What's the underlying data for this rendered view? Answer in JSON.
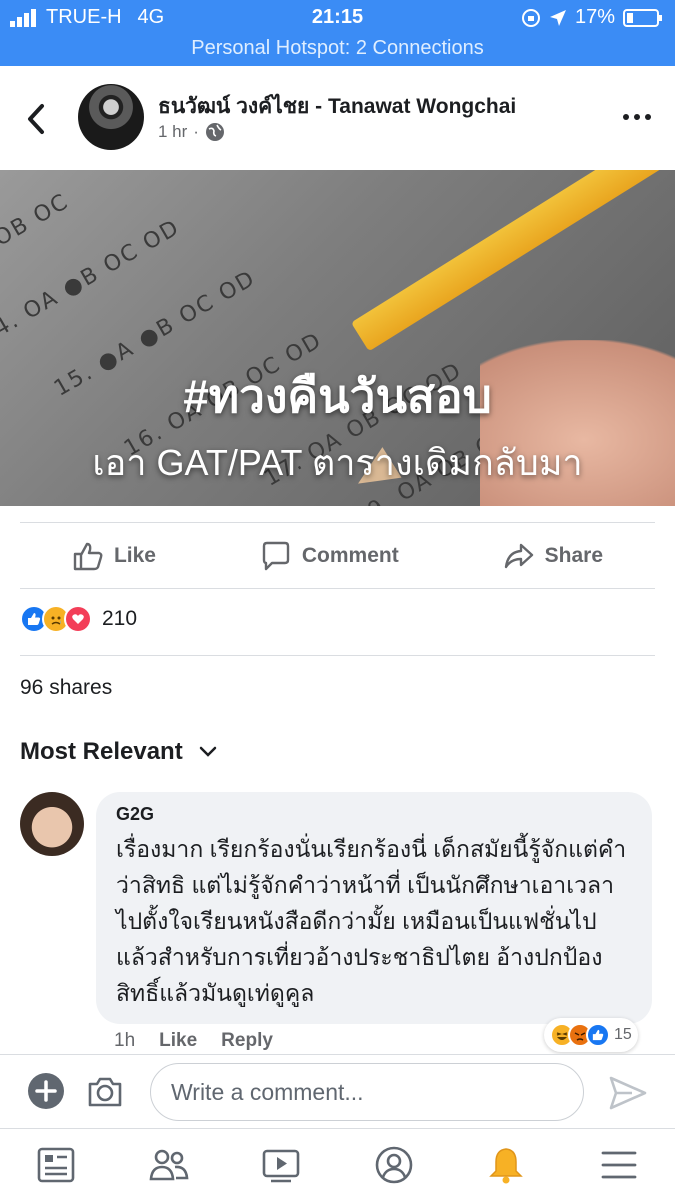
{
  "status_bar": {
    "carrier": "TRUE-H",
    "network": "4G",
    "time": "21:15",
    "battery": "17%"
  },
  "hotspot_banner": "Personal Hotspot: 2 Connections",
  "post": {
    "author": "ธนวัฒน์ วงค์ไชย - Tanawat Wongchai",
    "time_ago": "1 hr",
    "privacy_icon": "globe-icon",
    "image": {
      "title": "#ทวงคืนวันสอบ",
      "subtitle": "เอา GAT/PAT ตารางเดิมกลับมา",
      "sheet_rows": [
        "OB OC",
        "4. OA ●B OC OD",
        "15. ●A ●B OC OD",
        "16. OA OB OC OD",
        "17. OA OB OC OD",
        "19. OA OB OC OD"
      ]
    }
  },
  "actions": {
    "like": "Like",
    "comment": "Comment",
    "share": "Share"
  },
  "reactions": {
    "icons": [
      "like-icon",
      "sad-icon",
      "love-icon"
    ],
    "count": "210"
  },
  "shares": "96 shares",
  "sort_label": "Most Relevant",
  "comment": {
    "author": "G2G",
    "text": "เรื่องมาก เรียกร้องนั่นเรียกร้องนี่ เด็กสมัยนี้รู้จักแต่คำว่าสิทธิ แต่ไม่รู้จักคำว่าหน้าที่ เป็นนักศึกษาเอาเวลาไปตั้งใจเรียนหนังสือดีกว่ามั้ย เหมือนเป็นแฟชั่นไปแล้วสำหรับการเที่ยวอ้างประชาธิปไตย อ้างปกป้องสิทธิ์แล้วมันดูเท่ดูคูล",
    "time": "1h",
    "like": "Like",
    "reply": "Reply",
    "reaction_icons": [
      "haha-icon",
      "angry-icon",
      "like-icon"
    ],
    "reaction_count": "15"
  },
  "composer": {
    "placeholder": "Write a comment..."
  },
  "colors": {
    "status_bar": "#3b8cf5",
    "like_blue": "#1877f2",
    "love_red": "#f33e58",
    "sad_yellow": "#f7b125",
    "muted_text": "#65676b"
  },
  "tabs": [
    "news-feed-icon",
    "friends-icon",
    "watch-icon",
    "profile-icon",
    "notifications-icon",
    "menu-icon"
  ]
}
